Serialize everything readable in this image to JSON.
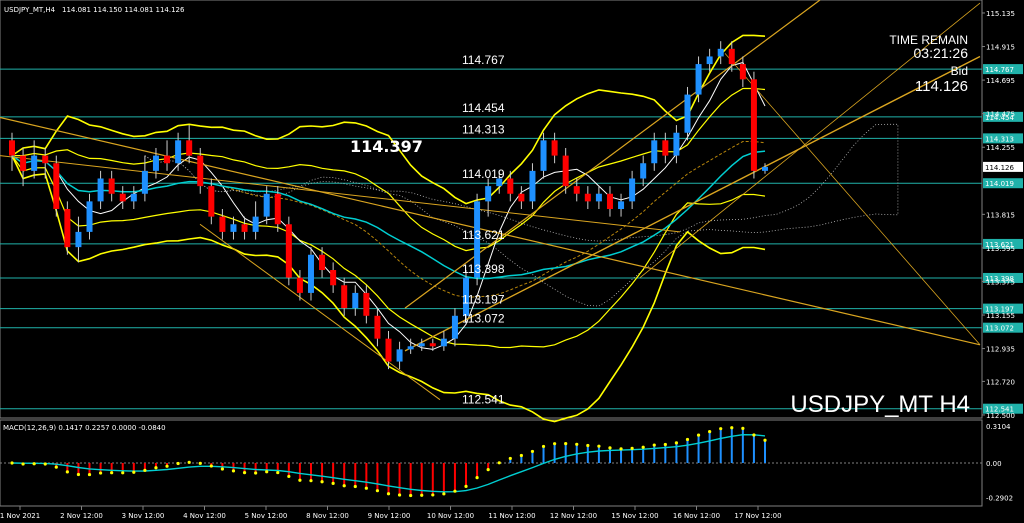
{
  "header": {
    "symbol": "USDJPY_MT,H4",
    "ohlc": "114.081 114.150 114.081 114.126"
  },
  "info": {
    "time_remain_label": "TIME REMAIN",
    "time_remain_value": "03:21:26",
    "bid_label": "Bid",
    "bid_value": "114.126"
  },
  "watermark": "USDJPY_MT H4",
  "highlight_label": "114.397",
  "macd_header": "MACD(12,26,9) 0.1417 0.2257 0.0000 -0.0840",
  "colors": {
    "background": "#000000",
    "bull_candle": "#1e90ff",
    "bear_candle": "#ff0000",
    "level_line": "#20b2aa",
    "bands": "#ffff00",
    "trendline": "#daa520",
    "ma": "#00ced1",
    "axis_text": "#ffffff"
  },
  "chart_data": {
    "type": "candlestick",
    "symbol": "USDJPY_MT",
    "timeframe": "H4",
    "ylim": [
      112.48,
      115.22
    ],
    "price_ticks": [
      115.135,
      114.915,
      114.695,
      114.475,
      114.255,
      113.815,
      113.595,
      113.375,
      113.155,
      112.935,
      112.72,
      112.5
    ],
    "levels": [
      114.767,
      114.454,
      114.313,
      114.019,
      113.621,
      113.398,
      113.197,
      113.072,
      112.541
    ],
    "current_bid": 114.126,
    "time_ticks": [
      "1 Nov 2021",
      "2 Nov 12:00",
      "3 Nov 12:00",
      "4 Nov 12:00",
      "5 Nov 12:00",
      "8 Nov 12:00",
      "9 Nov 12:00",
      "10 Nov 12:00",
      "11 Nov 12:00",
      "12 Nov 12:00",
      "15 Nov 12:00",
      "16 Nov 12:00",
      "17 Nov 12:00"
    ],
    "candles": [
      [
        114.3,
        114.2,
        114.35,
        114.1
      ],
      [
        114.2,
        114.1,
        114.25,
        114.0
      ],
      [
        114.1,
        114.2,
        114.3,
        114.05
      ],
      [
        114.2,
        114.15,
        114.25,
        114.05
      ],
      [
        114.15,
        113.85,
        114.2,
        113.8
      ],
      [
        113.85,
        113.6,
        113.9,
        113.55
      ],
      [
        113.6,
        113.7,
        113.8,
        113.5
      ],
      [
        113.7,
        113.9,
        113.95,
        113.65
      ],
      [
        113.9,
        114.05,
        114.1,
        113.85
      ],
      [
        114.05,
        113.95,
        114.1,
        113.9
      ],
      [
        113.95,
        113.9,
        114.0,
        113.85
      ],
      [
        113.9,
        113.95,
        114.0,
        113.85
      ],
      [
        113.95,
        114.1,
        114.2,
        113.9
      ],
      [
        114.1,
        114.2,
        114.25,
        114.05
      ],
      [
        114.2,
        114.15,
        114.3,
        114.1
      ],
      [
        114.15,
        114.3,
        114.35,
        114.1
      ],
      [
        114.3,
        114.2,
        114.4,
        114.15
      ],
      [
        114.2,
        114.0,
        114.25,
        113.95
      ],
      [
        114.0,
        113.8,
        114.05,
        113.75
      ],
      [
        113.8,
        113.7,
        113.85,
        113.65
      ],
      [
        113.7,
        113.75,
        113.8,
        113.65
      ],
      [
        113.75,
        113.7,
        113.8,
        113.65
      ],
      [
        113.7,
        113.8,
        113.9,
        113.65
      ],
      [
        113.8,
        113.95,
        114.0,
        113.75
      ],
      [
        113.95,
        113.75,
        114.0,
        113.7
      ],
      [
        113.75,
        113.4,
        113.8,
        113.35
      ],
      [
        113.4,
        113.3,
        113.45,
        113.25
      ],
      [
        113.3,
        113.55,
        113.6,
        113.25
      ],
      [
        113.55,
        113.45,
        113.6,
        113.4
      ],
      [
        113.45,
        113.35,
        113.5,
        113.3
      ],
      [
        113.35,
        113.2,
        113.4,
        113.15
      ],
      [
        113.2,
        113.3,
        113.35,
        113.15
      ],
      [
        113.3,
        113.15,
        113.35,
        113.1
      ],
      [
        113.15,
        113.0,
        113.2,
        112.95
      ],
      [
        113.0,
        112.85,
        113.05,
        112.8
      ],
      [
        112.85,
        112.93,
        112.98,
        112.8
      ],
      [
        112.93,
        112.95,
        113.0,
        112.9
      ],
      [
        112.95,
        112.97,
        113.0,
        112.92
      ],
      [
        112.97,
        112.95,
        113.0,
        112.92
      ],
      [
        112.95,
        113.0,
        113.05,
        112.92
      ],
      [
        113.0,
        113.15,
        113.2,
        112.95
      ],
      [
        113.15,
        113.4,
        113.45,
        113.1
      ],
      [
        113.4,
        113.9,
        113.95,
        113.35
      ],
      [
        113.9,
        114.0,
        114.05,
        113.8
      ],
      [
        114.0,
        114.05,
        114.1,
        113.95
      ],
      [
        114.05,
        113.95,
        114.1,
        113.9
      ],
      [
        113.95,
        113.9,
        114.0,
        113.85
      ],
      [
        113.9,
        114.1,
        114.15,
        113.85
      ],
      [
        114.1,
        114.3,
        114.35,
        114.05
      ],
      [
        114.3,
        114.2,
        114.35,
        114.15
      ],
      [
        114.2,
        114.0,
        114.25,
        113.95
      ],
      [
        114.0,
        113.95,
        114.05,
        113.9
      ],
      [
        113.95,
        113.9,
        114.0,
        113.85
      ],
      [
        113.9,
        113.95,
        114.0,
        113.85
      ],
      [
        113.95,
        113.85,
        114.0,
        113.8
      ],
      [
        113.85,
        113.9,
        113.95,
        113.8
      ],
      [
        113.9,
        114.05,
        114.1,
        113.85
      ],
      [
        114.05,
        114.15,
        114.2,
        114.0
      ],
      [
        114.15,
        114.3,
        114.35,
        114.1
      ],
      [
        114.3,
        114.2,
        114.35,
        114.15
      ],
      [
        114.2,
        114.35,
        114.4,
        114.15
      ],
      [
        114.35,
        114.6,
        114.65,
        114.3
      ],
      [
        114.6,
        114.8,
        114.85,
        114.55
      ],
      [
        114.8,
        114.85,
        114.9,
        114.75
      ],
      [
        114.85,
        114.9,
        114.95,
        114.8
      ],
      [
        114.9,
        114.8,
        114.95,
        114.75
      ],
      [
        114.8,
        114.7,
        114.85,
        114.65
      ],
      [
        114.7,
        114.1,
        114.75,
        114.05
      ],
      [
        114.1,
        114.126,
        114.15,
        114.081
      ]
    ],
    "macd": {
      "header": "MACD(12,26,9) 0.1417 0.2257 0.0000 -0.0840",
      "ylim": [
        -0.36,
        0.36
      ],
      "ticks": [
        0.3104,
        0.0,
        -0.2902
      ]
    }
  }
}
